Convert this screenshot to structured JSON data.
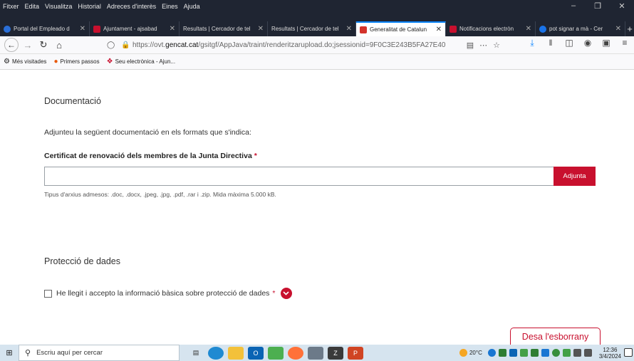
{
  "menubar": {
    "items": [
      "Fitxer",
      "Edita",
      "Visualitza",
      "Historial",
      "Adreces d'interès",
      "Eines",
      "Ajuda"
    ]
  },
  "tabs": [
    {
      "label": "Portal del Empleado d",
      "color": "#2a6fd8"
    },
    {
      "label": "Ajuntament - ajsabad",
      "color": "#c8102e"
    },
    {
      "label": "Resultats | Cercador de tel",
      "color": "#1f2532"
    },
    {
      "label": "Resultats | Cercador de tel",
      "color": "#1f2532"
    },
    {
      "label": "Generalitat de Catalun",
      "color": "#d3322b",
      "active": true
    },
    {
      "label": "Notificacions electròn",
      "color": "#c8102e"
    },
    {
      "label": "pot signar a mà - Cer",
      "color": "#1a73e8"
    }
  ],
  "navbar": {
    "url_prefix": "https://ovt.",
    "url_domain": "gencat.cat",
    "url_path": "/gsitgf/AppJava/traint/renderitzarupload.do;jsessionid=9F0C3E243B5FA27E40"
  },
  "bookmarks": [
    {
      "label": "Més visitades",
      "color": "#444"
    },
    {
      "label": "Primers passos",
      "color": "#e8590c"
    },
    {
      "label": "Seu electrònica - Ajun...",
      "color": "#c8102e"
    }
  ],
  "form": {
    "section1_title": "Documentació",
    "intro": "Adjunteu la següent documentació en els formats que s'indica:",
    "field_label": "Certificat de renovació dels membres de la Junta Directiva",
    "required_mark": "*",
    "file_value": "",
    "attach_button": "Adjunta",
    "help_text": "Tipus d'arxius admesos: .doc, .docx, .jpeg, .jpg, .pdf, .rar i .zip. Mida màxima 5.000 kB.",
    "section2_title": "Protecció de dades",
    "consent_label": "He llegit i accepto la informació bàsica sobre protecció de dades",
    "consent_checked": false,
    "draft_button": "Desa l'esborrany"
  },
  "taskbar": {
    "search_placeholder": "Escriu aquí per cercar",
    "weather": "20°C",
    "time": "12:36",
    "date": "3/4/2024"
  },
  "colors": {
    "accent": "#c8102e",
    "chrome_dark": "#1f2532",
    "taskbar": "#d6e4ef"
  }
}
